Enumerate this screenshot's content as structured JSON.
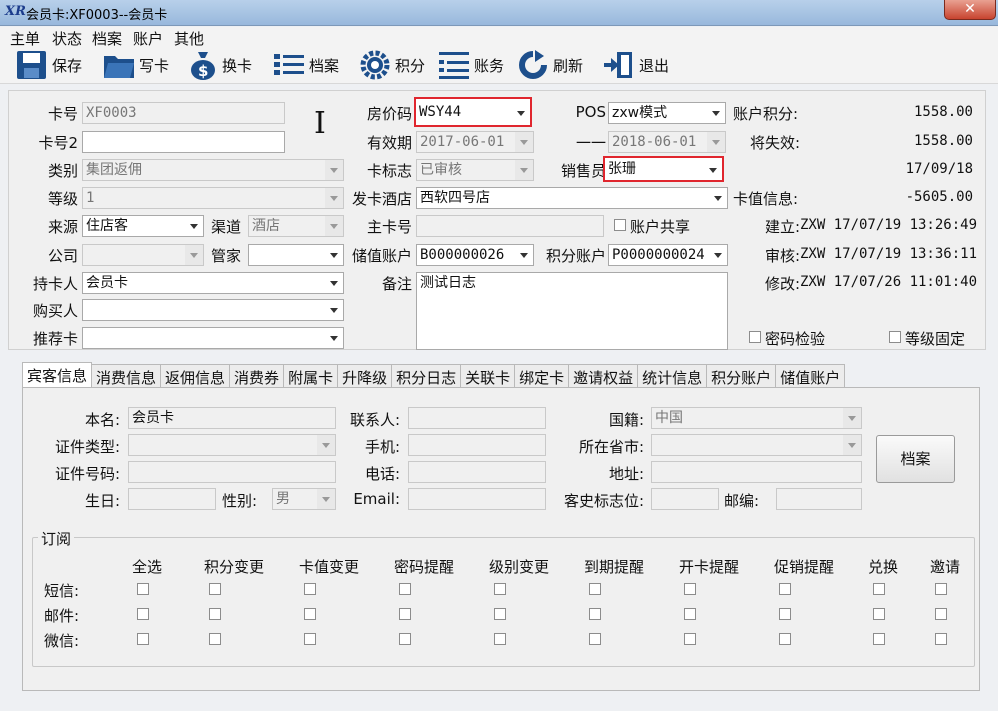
{
  "window": {
    "title": "会员卡:XF0003--会员卡",
    "close": "✕"
  },
  "menu": [
    "主单",
    "状态",
    "档案",
    "账户",
    "其他"
  ],
  "toolbar": [
    {
      "label": "保存",
      "icon": "save-icon"
    },
    {
      "label": "写卡",
      "icon": "folder-icon"
    },
    {
      "label": "换卡",
      "icon": "money-bag-icon"
    },
    {
      "label": "档案",
      "icon": "list-icon"
    },
    {
      "label": "积分",
      "icon": "gear-icon"
    },
    {
      "label": "账务",
      "icon": "ledger-icon"
    },
    {
      "label": "刷新",
      "icon": "refresh-icon"
    },
    {
      "label": "退出",
      "icon": "exit-icon"
    }
  ],
  "form": {
    "card_no": {
      "label": "卡号",
      "value": "XF0003"
    },
    "card_no2": {
      "label": "卡号2",
      "value": ""
    },
    "category": {
      "label": "类别",
      "value": "集团返佣"
    },
    "level": {
      "label": "等级",
      "value": "1"
    },
    "source": {
      "label": "来源",
      "value": "住店客"
    },
    "channel": {
      "label": "渠道",
      "value": "酒店"
    },
    "company": {
      "label": "公司",
      "value": ""
    },
    "housekeeper": {
      "label": "管家",
      "value": ""
    },
    "holder": {
      "label": "持卡人",
      "value": "会员卡"
    },
    "buyer": {
      "label": "购买人",
      "value": ""
    },
    "referrer": {
      "label": "推荐卡",
      "value": ""
    },
    "room_rate": {
      "label": "房价码",
      "value": "WSY44"
    },
    "pos": {
      "label": "POS",
      "value": "zxw模式"
    },
    "valid_from": {
      "label": "有效期",
      "value": "2017-06-01"
    },
    "valid_sep": {
      "label": "一一",
      "value": "2018-06-01"
    },
    "card_flag": {
      "label": "卡标志",
      "value": "已审核"
    },
    "sales": {
      "label": "销售员",
      "value": "张珊"
    },
    "issuing_hotel": {
      "label": "发卡酒店",
      "value": "西软四号店"
    },
    "main_card": {
      "label": "主卡号",
      "value": ""
    },
    "account_share": {
      "label": "账户共享"
    },
    "stored_account": {
      "label": "储值账户",
      "value": "B000000026"
    },
    "points_account": {
      "label": "积分账户",
      "value": "P0000000024"
    },
    "remark": {
      "label": "备注",
      "value": "测试日志"
    },
    "password_check": {
      "label": "密码检验"
    },
    "level_fixed": {
      "label": "等级固定"
    }
  },
  "stats": {
    "points": {
      "label": "账户积分:",
      "value": "1558.00"
    },
    "expiring": {
      "label": "将失效:",
      "value": "1558.00"
    },
    "expire_date": "17/09/18",
    "card_value": {
      "label": "卡值信息:",
      "value": "-5605.00"
    },
    "created": {
      "label": "建立:",
      "value": "ZXW 17/07/19 13:26:49"
    },
    "audited": {
      "label": "审核:",
      "value": "ZXW 17/07/19 13:36:11"
    },
    "modified": {
      "label": "修改:",
      "value": "ZXW 17/07/26 11:01:40"
    }
  },
  "tabs": [
    "宾客信息",
    "消费信息",
    "返佣信息",
    "消费券",
    "附属卡",
    "升降级",
    "积分日志",
    "关联卡",
    "绑定卡",
    "邀请权益",
    "统计信息",
    "积分账户",
    "储值账户"
  ],
  "guest": {
    "name": {
      "label": "本名:",
      "value": "会员卡"
    },
    "contact": {
      "label": "联系人:",
      "value": ""
    },
    "nationality": {
      "label": "国籍:",
      "value": "中国"
    },
    "id_type": {
      "label": "证件类型:",
      "value": ""
    },
    "mobile": {
      "label": "手机:",
      "value": ""
    },
    "province": {
      "label": "所在省市:",
      "value": ""
    },
    "id_no": {
      "label": "证件号码:",
      "value": ""
    },
    "phone": {
      "label": "电话:",
      "value": ""
    },
    "address": {
      "label": "地址:",
      "value": ""
    },
    "birthday": {
      "label": "生日:",
      "value": ""
    },
    "gender": {
      "label": "性别:",
      "value": "男"
    },
    "email": {
      "label": "Email:",
      "value": ""
    },
    "history_flag": {
      "label": "客史标志位:",
      "value": ""
    },
    "zip": {
      "label": "邮编:",
      "value": ""
    },
    "archive_button": "档案"
  },
  "subscription": {
    "title": "订阅",
    "columns": [
      "全选",
      "积分变更",
      "卡值变更",
      "密码提醒",
      "级别变更",
      "到期提醒",
      "开卡提醒",
      "促销提醒",
      "兑换",
      "邀请"
    ],
    "rows": [
      "短信:",
      "邮件:",
      "微信:"
    ]
  },
  "colors": {
    "highlight": "#e0262e",
    "title_bar": "#a8c4e4"
  }
}
